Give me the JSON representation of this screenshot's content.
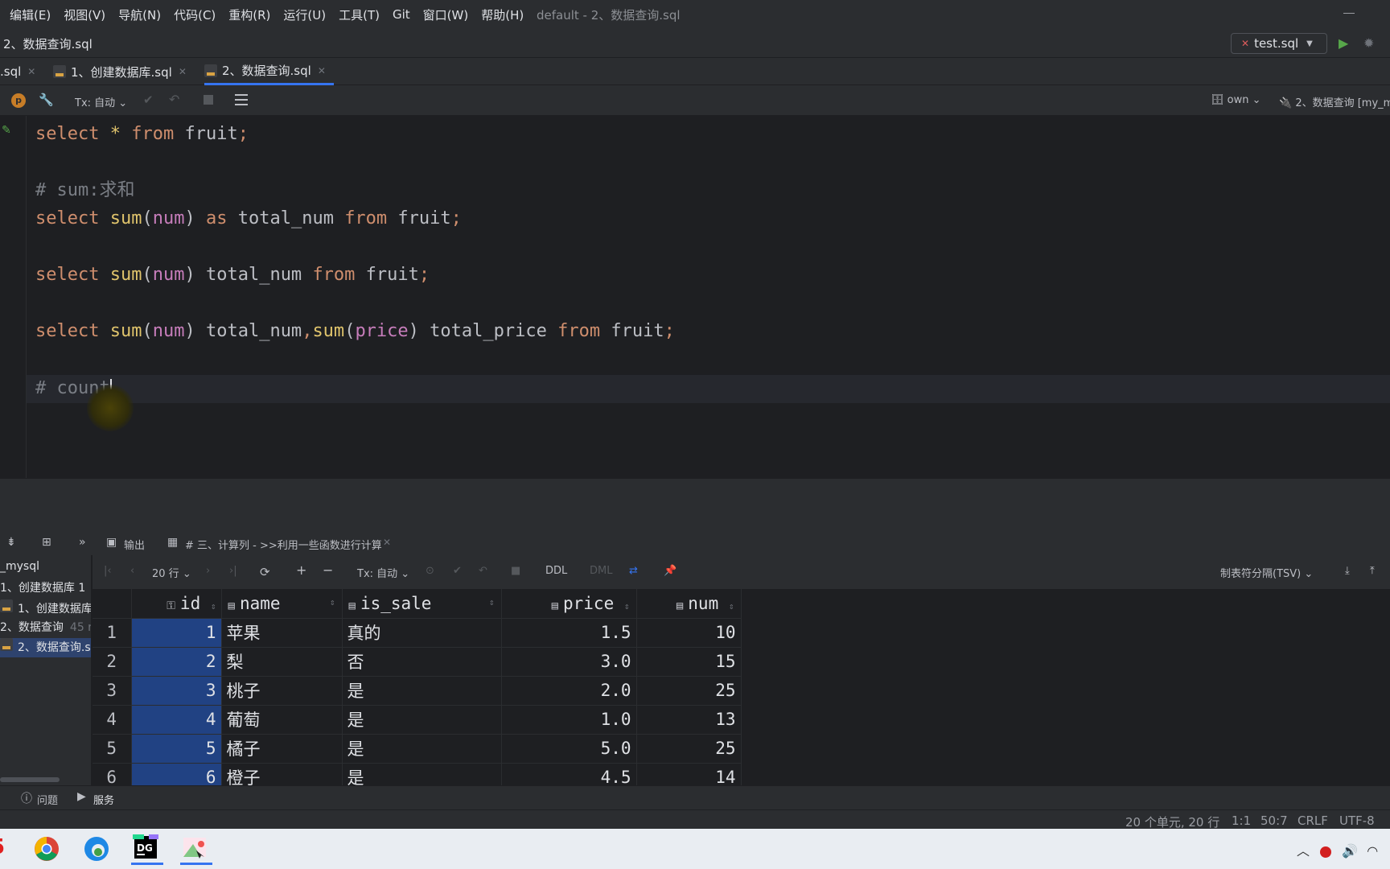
{
  "menubar": {
    "items": [
      "编辑(E)",
      "视图(V)",
      "导航(N)",
      "代码(C)",
      "重构(R)",
      "运行(U)",
      "工具(T)",
      "Git",
      "窗口(W)",
      "帮助(H)"
    ],
    "title": "default - 2、数据查询.sql"
  },
  "navbar": {
    "breadcrumb": "2、数据查询.sql",
    "run_config": "test.sql"
  },
  "tabs": [
    {
      "label": ".sql",
      "active": false
    },
    {
      "label": "1、创建数据库.sql",
      "active": false
    },
    {
      "label": "2、数据查询.sql",
      "active": true
    }
  ],
  "editor_toolbar": {
    "tx_mode": "Tx: 自动",
    "schema": "own",
    "session": "2、数据查询 [my_m"
  },
  "code_lines": [
    "select * from fruit;",
    "# sum:求和",
    "select sum(num) as total_num from fruit;",
    "select sum(num) total_num from fruit;",
    "select sum(num) total_num,sum(price) total_price from fruit;",
    "# count"
  ],
  "services": {
    "output_tab": "输出",
    "result_tab": "# 三、计算列 - >>利用一些函数进行计算",
    "tree": [
      {
        "label": "_mysql",
        "extra": ""
      },
      {
        "label": "1、创建数据库 1",
        "extra": ""
      },
      {
        "label": "1、创建数据库",
        "extra": ""
      },
      {
        "label": "2、数据查询",
        "extra": "45 r"
      },
      {
        "label": "2、数据查询.s",
        "extra": ""
      }
    ]
  },
  "result_toolbar": {
    "rows": "20 行",
    "tx_mode": "Tx: 自动",
    "ddl": "DDL",
    "dml": "DML",
    "export_format": "制表符分隔(TSV)"
  },
  "table": {
    "columns": [
      "id",
      "name",
      "is_sale",
      "price",
      "num"
    ],
    "rows": [
      {
        "rn": "1",
        "id": "1",
        "name": "苹果",
        "is_sale": "真的",
        "price": "1.5",
        "num": "10"
      },
      {
        "rn": "2",
        "id": "2",
        "name": "梨",
        "is_sale": "否",
        "price": "3.0",
        "num": "15"
      },
      {
        "rn": "3",
        "id": "3",
        "name": "桃子",
        "is_sale": "是",
        "price": "2.0",
        "num": "25"
      },
      {
        "rn": "4",
        "id": "4",
        "name": "葡萄",
        "is_sale": "是",
        "price": "1.0",
        "num": "13"
      },
      {
        "rn": "5",
        "id": "5",
        "name": "橘子",
        "is_sale": "是",
        "price": "5.0",
        "num": "25"
      },
      {
        "rn": "6",
        "id": "6",
        "name": "橙子",
        "is_sale": "是",
        "price": "4.5",
        "num": "14"
      }
    ]
  },
  "bottom_tabs": {
    "problems": "问题",
    "services": "服务"
  },
  "status": {
    "summary": "20 个单元, 20 行",
    "pos1": "1:1",
    "pos2": "50:7",
    "line_sep": "CRLF",
    "encoding": "UTF-8"
  }
}
